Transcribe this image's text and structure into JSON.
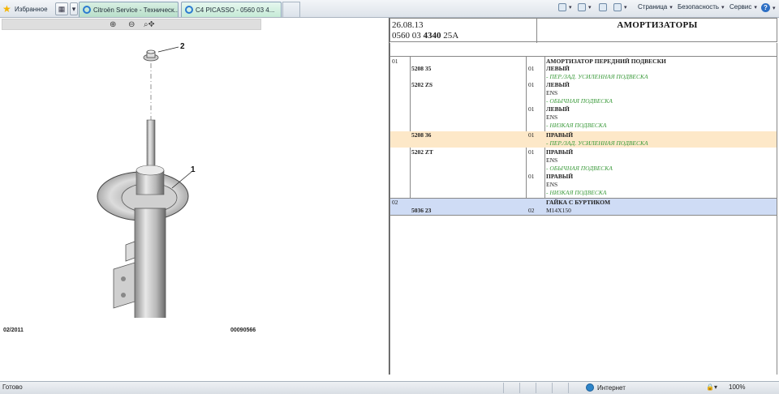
{
  "toolbar": {
    "favorites_label": "Избранное",
    "tabs": [
      {
        "label": "Citroën Service - Техническ..."
      },
      {
        "label": "C4 PICASSO - 0560 03 4...",
        "close": "×"
      }
    ],
    "commands": {
      "page": "Страница",
      "safety": "Безопасность",
      "tools": "Сервис",
      "help": "?"
    }
  },
  "illustration": {
    "callout_1": "1",
    "callout_2": "2",
    "date": "02/2011",
    "code": "00090566"
  },
  "header": {
    "date": "26.08.13",
    "code_prefix": "0560 03 ",
    "code_bold": "4340",
    "code_suffix": " 25A",
    "title": "АМОРТИЗАТОРЫ"
  },
  "parts": {
    "r1": {
      "ref": "01",
      "desc": "АМОРТИЗАТОР ПЕРЕДНИЙ ПОДВЕСКИ"
    },
    "r2": {
      "part": "5208 35",
      "qty": "01",
      "desc": "ЛЕВЫЙ",
      "note": "- ПЕР./ЗАД. УСИЛЕННАЯ ПОДВЕСКА"
    },
    "r3": {
      "part": "5202 ZS",
      "qty": "01",
      "desc": "ЛЕВЫЙ",
      "sub": "ENS",
      "note": "- ОБЫЧНАЯ ПОДВЕСКА"
    },
    "r4": {
      "qty": "01",
      "desc": "ЛЕВЫЙ",
      "sub": "ENS",
      "note": "- НИЗКАЯ ПОДВЕСКА"
    },
    "r5": {
      "part": "5208 36",
      "qty": "01",
      "desc": "ПРАВЫЙ",
      "note": "- ПЕР./ЗАД. УСИЛЕННАЯ ПОДВЕСКА"
    },
    "r6": {
      "part": "5202 ZT",
      "qty": "01",
      "desc": "ПРАВЫЙ",
      "sub": "ENS",
      "note": "- ОБЫЧНАЯ ПОДВЕСКА"
    },
    "r7": {
      "qty": "01",
      "desc": "ПРАВЫЙ",
      "sub": "ENS",
      "note": "- НИЗКАЯ ПОДВЕСКА"
    },
    "r8": {
      "ref": "02",
      "part": "5036 23",
      "qty": "02",
      "desc": "ГАЙКА С БУРТИКОМ",
      "sub": "M14X150"
    }
  },
  "status": {
    "text": "Готово",
    "zone": "Интернет",
    "zoom": "100%"
  },
  "colors": {
    "highlight_orange": "#fde8c8",
    "highlight_blue": "#cfdcf5",
    "note_green": "#3a9a3a"
  }
}
